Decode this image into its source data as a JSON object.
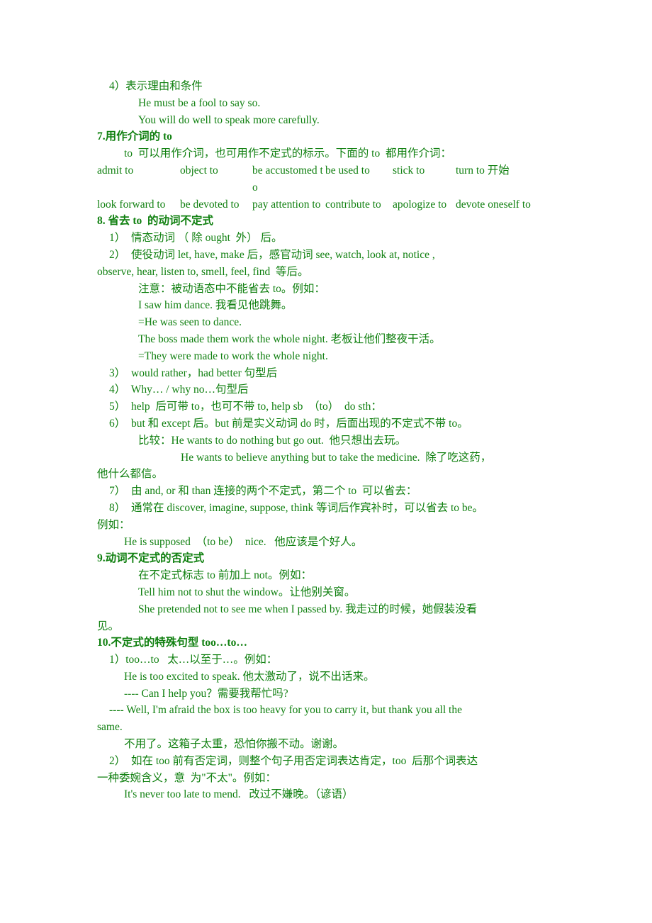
{
  "document": {
    "text_color": "#108010",
    "background_color": "#ffffff"
  },
  "lines": {
    "l01": "4）表示理由和条件",
    "l02": "He must be a fool to say so.",
    "l03": "You will do well to speak more carefully.",
    "h07": "7.用作介词的 to",
    "l04": "to  可以用作介词，也可用作不定式的标示。下面的 to  都用作介词：",
    "h08": "8. 省去 to  的动词不定式",
    "l05": "1）  情态动词 （ 除 ought  外） 后。",
    "l06": "2）  使役动词 let, have, make 后，感官动词 see, watch, look at, notice ,",
    "l07": "observe, hear, listen to, smell, feel, find  等后。",
    "l08": "注意：被动语态中不能省去 to。例如：",
    "l09": "I saw him dance. 我看见他跳舞。",
    "l10": "=He was seen to dance.",
    "l11": "The boss made them work the whole night. 老板让他们整夜干活。",
    "l12": "=They were made to work the whole night.",
    "l13": "3）  would rather，had better 句型后",
    "l14": "4）  Why… / why no…句型后",
    "l15": "5）  help  后可带 to，也可不带 to, help sb  （to）  do sth：",
    "l16": "6）  but 和 except 后。but 前是实义动词 do 时，后面出现的不定式不带 to。",
    "l17": "比较：He wants to do nothing but go out.  他只想出去玩。",
    "l18": "He wants to believe anything but to take the medicine.  除了吃这药，",
    "l19": "他什么都信。",
    "l20": "7）  由 and, or 和 than 连接的两个不定式，第二个 to  可以省去：",
    "l21": "8）  通常在 discover, imagine, suppose, think 等词后作宾补时，可以省去 to be。",
    "l22": "例如：",
    "l23": "He is supposed  （to be）  nice.   他应该是个好人。",
    "h09": "9.动词不定式的否定式",
    "l24": "在不定式标志 to 前加上 not。例如：",
    "l25": "Tell him not to shut the window。让他别关窗。",
    "l26": "She pretended not to see me when I passed by. 我走过的时候，她假装没看",
    "l27": "见。",
    "h10": "10.不定式的特殊句型 too…to…",
    "l28": "1）too…to   太…以至于…。例如：",
    "l29": "He is too excited to speak. 他太激动了，说不出话来。",
    "l30": "---- Can I help you？需要我帮忙吗?",
    "l31": "---- Well, I'm afraid the box is too heavy for you to carry it, but thank you all the",
    "l32": "same.",
    "l33": "不用了。这箱子太重，恐怕你搬不动。谢谢。",
    "l34": "2）  如在 too 前有否定词，则整个句子用否定词表达肯定，too  后那个词表达",
    "l35": "一种委婉含义，意  为\"不太\"。例如：",
    "l36": "It's never too late to mend.   改过不嫌晚。（谚语）"
  },
  "to_table": {
    "rows": [
      [
        "admit  to",
        "object  to",
        "be accustomed  to",
        "be used to",
        "stick to",
        "turn to 开始"
      ],
      [
        "look  forward to",
        "be devoted  to",
        "pay attention to",
        "contribute to",
        "apologize to",
        "devote oneself to"
      ]
    ]
  }
}
